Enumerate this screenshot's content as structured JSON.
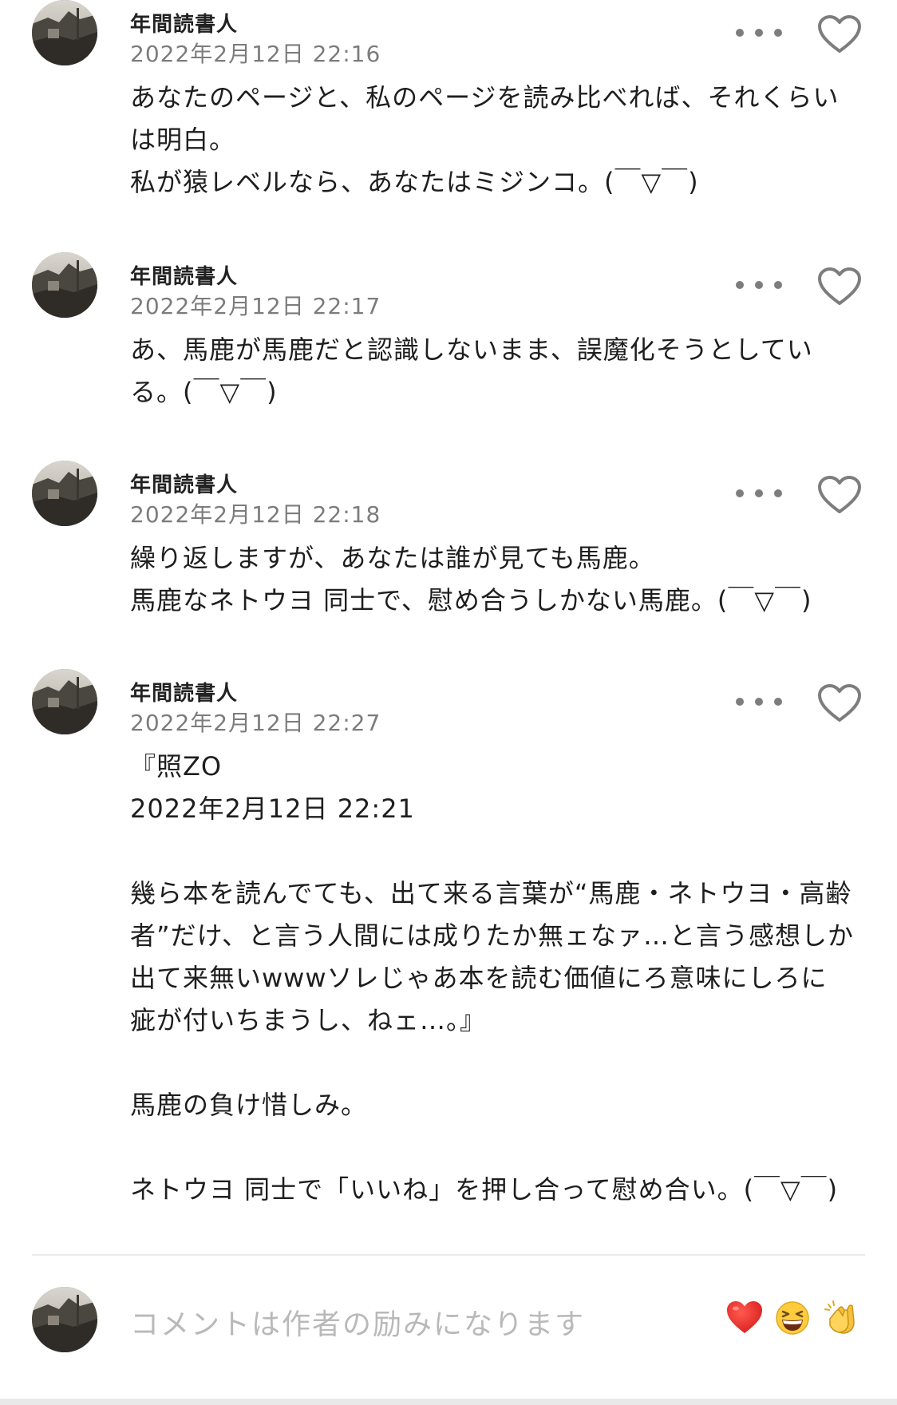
{
  "comments": [
    {
      "author": "年間読書人",
      "date": "2022年2月12日 22:16",
      "lines": [
        "あなたのページと、私のページを読み比べれば、それくらい",
        "は明白。",
        "私が猿レベルなら、あなたはミジンコ。(￣▽￣)"
      ]
    },
    {
      "author": "年間読書人",
      "date": "2022年2月12日 22:17",
      "lines": [
        "あ、馬鹿が馬鹿だと認識しないまま、誤魔化そうとしてい",
        "る。(￣▽￣)"
      ]
    },
    {
      "author": "年間読書人",
      "date": "2022年2月12日 22:18",
      "lines": [
        "繰り返しますが、あなたは誰が見ても馬鹿。",
        "馬鹿なネトウヨ 同士で、慰め合うしかない馬鹿。(￣▽￣)"
      ]
    },
    {
      "author": "年間読書人",
      "date": "2022年2月12日 22:27",
      "lines": [
        "『照ZO",
        "2022年2月12日 22:21",
        "",
        "幾ら本を読んでても、出て来る言葉が“馬鹿・ネトウヨ・高齢",
        "者”だけ、と言う人間には成りたか無ェなァ…と言う感想しか",
        "出て来無いwwwソレじゃあ本を読む価値にろ意味にしろに",
        "疵が付いちまうし、ねェ…。』",
        "",
        "馬鹿の負け惜しみ。",
        "",
        "ネトウヨ 同士で「いいね」を押し合って慰め合い。(￣▽￣)"
      ]
    }
  ],
  "composer": {
    "placeholder": "コメントは作者の励みになります"
  },
  "reactions": [
    {
      "icon": "red-heart-icon",
      "emoji": "❤️"
    },
    {
      "icon": "grinning-squinting-face-icon",
      "emoji": "😆"
    },
    {
      "icon": "clapping-hands-icon",
      "emoji": "👏"
    }
  ],
  "colors": {
    "text": "#1e1e1e",
    "date": "#7c7c7c",
    "icon": "#7d7d7d",
    "placeholder": "#b9b9b9",
    "divider": "#ececec"
  }
}
